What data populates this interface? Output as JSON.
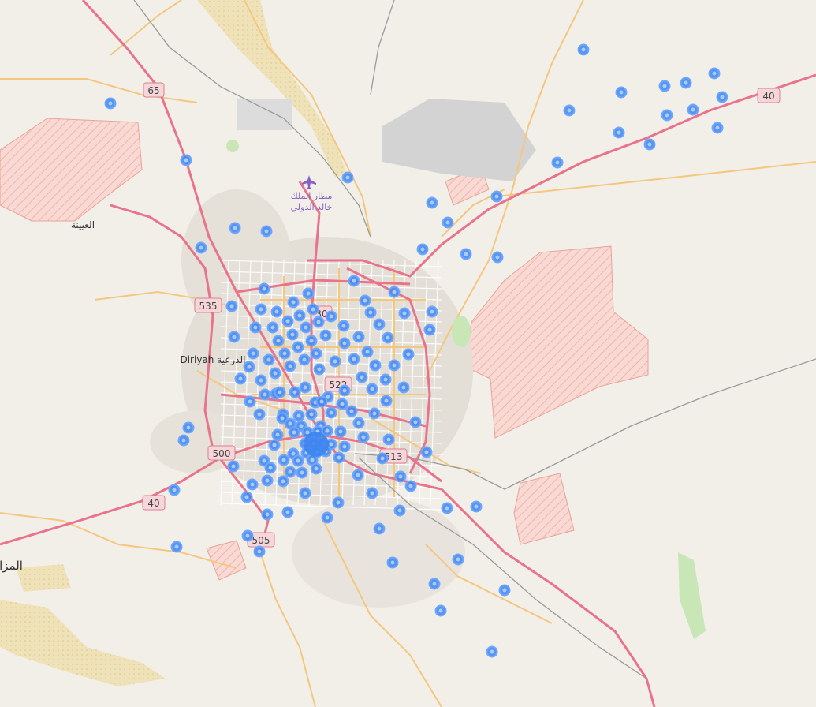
{
  "map": {
    "labels": {
      "diriyah": "Diriyah الدرعية",
      "uyaynah": "العيينة",
      "muzahimiyah": "المزا",
      "airport_line1": "مطار الملك",
      "airport_line2": "خالد الدولي"
    },
    "road_shields": {
      "r65": "65",
      "r535": "535",
      "r30": "30",
      "r522": "522",
      "r500": "500",
      "r513": "513",
      "r40_west": "40",
      "r40_east": "40",
      "r505": "505"
    },
    "marker_color": "#3d85f0",
    "marker_count": 168
  }
}
